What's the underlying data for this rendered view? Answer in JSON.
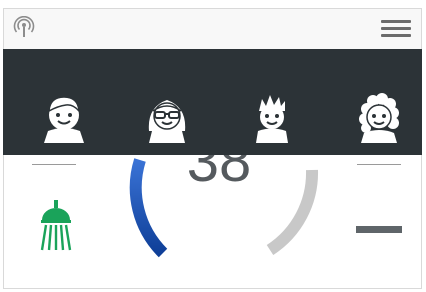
{
  "topbar": {
    "signal_icon": "broadcast-signal-icon",
    "menu_icon": "hamburger-menu-icon"
  },
  "users": [
    {
      "icon": "user-boy-icon"
    },
    {
      "icon": "user-girl-glasses-icon"
    },
    {
      "icon": "user-spiky-hair-icon"
    },
    {
      "icon": "user-curly-hair-icon"
    }
  ],
  "thermostat": {
    "temperature": "38",
    "gauge_colors": {
      "cold": "#1f5fbf",
      "warm": "#c7c7c7"
    }
  },
  "controls": {
    "shower_icon": "shower-head-icon",
    "shower_color": "#1aa35a",
    "minus_icon": "minus-icon"
  }
}
